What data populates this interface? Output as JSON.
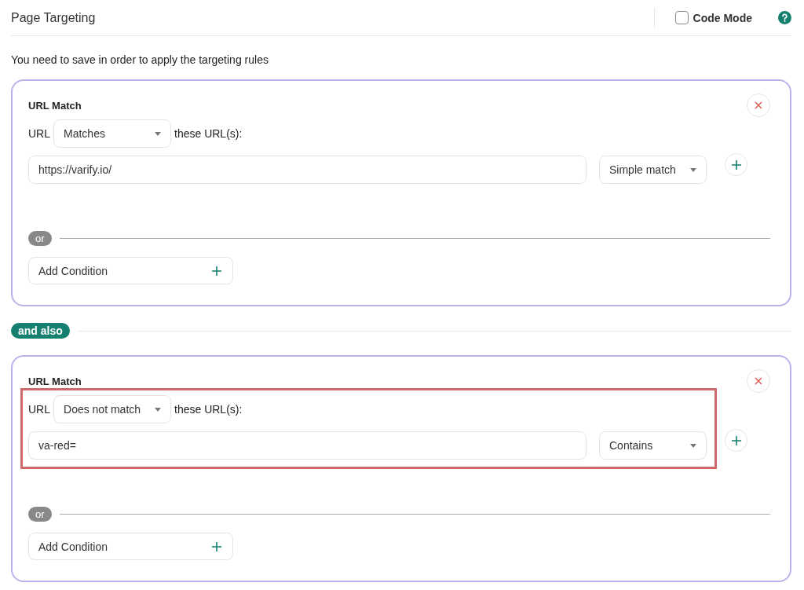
{
  "header": {
    "title": "Page Targeting",
    "code_mode": {
      "label": "Code Mode",
      "checked": false
    }
  },
  "notice": "You need to save in order to apply the targeting rules",
  "sections": [
    {
      "kind": "group",
      "title": "URL Match",
      "conditions": [
        {
          "prefix": "URL",
          "operator": "Matches",
          "suffix": "these URL(s):",
          "value": "https://varify.io/",
          "match_type": "Simple match",
          "highlighted": false
        }
      ],
      "or_label": "or",
      "add_label": "Add Condition"
    },
    {
      "kind": "joiner",
      "label": "and also"
    },
    {
      "kind": "group",
      "title": "URL Match",
      "conditions": [
        {
          "prefix": "URL",
          "operator": "Does not match",
          "suffix": "these URL(s):",
          "value": "va-red=",
          "match_type": "Contains",
          "highlighted": true
        }
      ],
      "or_label": "or",
      "add_label": "Add Condition"
    }
  ]
}
